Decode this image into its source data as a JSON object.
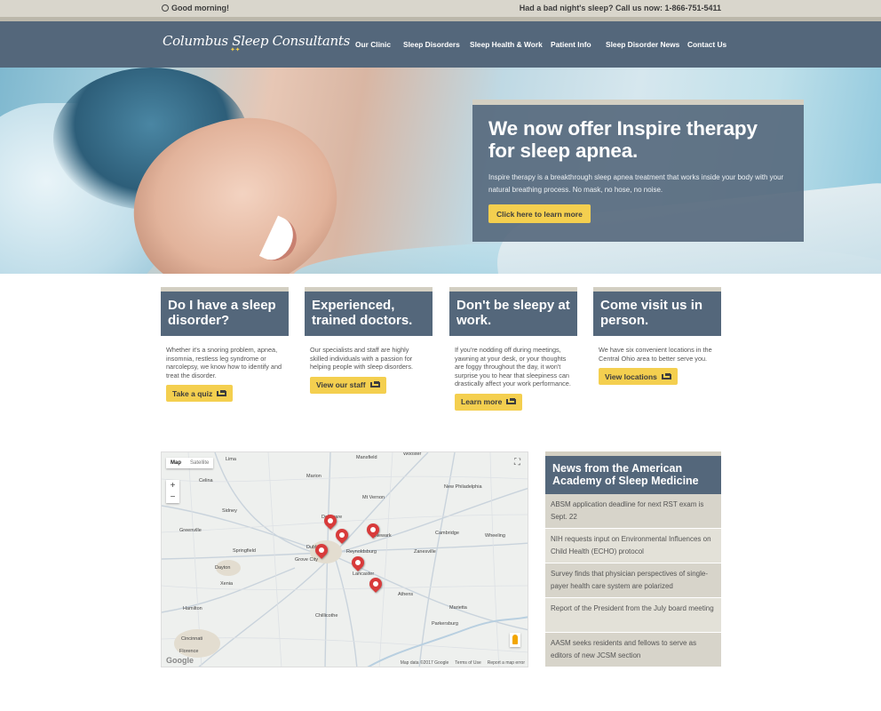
{
  "topbar": {
    "greeting": "Good morning!",
    "phone_text": "Had a bad night's sleep? Call us now: 1-866-751-5411"
  },
  "header": {
    "logo": "Columbus Sleep Consultants",
    "nav": [
      {
        "label": "Our Clinic"
      },
      {
        "label": "Sleep Disorders"
      },
      {
        "label": "Sleep Health & Work"
      },
      {
        "label": "Patient Info"
      },
      {
        "label": "Sleep Disorder News"
      },
      {
        "label": "Contact Us"
      }
    ]
  },
  "hero": {
    "title": "We now offer Inspire therapy for sleep apnea.",
    "body": "Inspire therapy is a breakthrough sleep apnea treatment that works inside your body with your natural breathing process. No mask, no hose, no noise.",
    "cta": "Click here to learn more"
  },
  "cards": [
    {
      "title": "Do I have a sleep disorder?",
      "body": "Whether it's a snoring problem, apnea, insomnia, restless leg syndrome or narcolepsy, we know how to identify and treat the disorder.",
      "cta": "Take a quiz"
    },
    {
      "title": "Experienced, trained doctors.",
      "body": "Our specialists and staff are highly skilled individuals with a passion for helping people with sleep disorders.",
      "cta": "View our staff"
    },
    {
      "title": "Don't be sleepy at work.",
      "body": "If you're nodding off during meetings, yawning at your desk, or your thoughts are foggy throughout the day, it won't surprise you to hear that sleepiness can drastically affect your work performance.",
      "cta": "Learn more"
    },
    {
      "title": "Come visit us in person.",
      "body": "We have six convenient locations in the Central Ohio area to better serve you.",
      "cta": "View locations"
    }
  ],
  "map": {
    "type_map": "Map",
    "type_satellite": "Satellite",
    "zoom_in": "+",
    "zoom_out": "−",
    "attribution_logo": "Google",
    "footer": [
      "Map data ©2017 Google",
      "Terms of Use",
      "Report a map error"
    ],
    "towns": [
      "Lima",
      "Celina",
      "Marion",
      "Mansfield",
      "Wooster",
      "New Philadelphia",
      "Mt Vernon",
      "Sidney",
      "Delaware",
      "Greenville",
      "Dublin",
      "Newark",
      "Springfield",
      "Dayton",
      "Reynoldsburg",
      "Zanesville",
      "Cambridge",
      "Grove City",
      "Lancaster",
      "Hamilton",
      "Chillicothe",
      "Marietta",
      "Parkersburg",
      "Cincinnati",
      "Athens",
      "Xenia",
      "Wheeling",
      "Florence"
    ]
  },
  "news": {
    "title": "News from the American Academy of Sleep Medicine",
    "items": [
      "ABSM application deadline for next RST exam is Sept. 22",
      "NIH requests input on Environmental Influences on Child Health (ECHO) protocol",
      "Survey finds that physician perspectives of single-payer health care system are polarized",
      "Report of the President from the July board meeting",
      "AASM seeks residents and fellows to serve as editors of new JCSM section"
    ]
  },
  "colors": {
    "slate": "#54677b",
    "accent_yellow": "#f4cf4f",
    "topbar": "#d9d6cc"
  }
}
